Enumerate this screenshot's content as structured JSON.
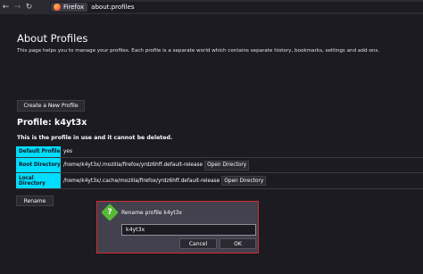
{
  "browser": {
    "back_label": "←",
    "forward_label": "→",
    "reload_label": "↻",
    "identity_label": "Firefox",
    "url": "about:profiles"
  },
  "page": {
    "title": "About Profiles",
    "description": "This page helps you to manage your profiles. Each profile is a separate world which contains separate history, bookmarks, settings and add-ons.",
    "create_button": "Create a New Profile"
  },
  "profile": {
    "heading": "Profile: k4yt3x",
    "note": "This is the profile in use and it cannot be deleted.",
    "rows": [
      {
        "key": "Default Profile",
        "value": "yes"
      },
      {
        "key": "Root Directory",
        "value": "/home/k4yt3x/.mozilla/firefox/yrdz6hff.default-release",
        "button": "Open Directory"
      },
      {
        "key": "Local Directory",
        "value": "/home/k4yt3x/.cache/mozilla/firefox/yrdz6hff.default-release",
        "button": "Open Directory"
      }
    ],
    "rename_button": "Rename"
  },
  "dialog": {
    "icon": "question-icon",
    "icon_glyph": "?",
    "title": "Rename profile k4yt3x",
    "input_value": "k4yt3x",
    "cancel_label": "Cancel",
    "ok_label": "OK",
    "border_color": "#d42b2b",
    "icon_color": "#58b938"
  },
  "colors": {
    "accent": "#00ddff",
    "background": "#1c1b22"
  }
}
